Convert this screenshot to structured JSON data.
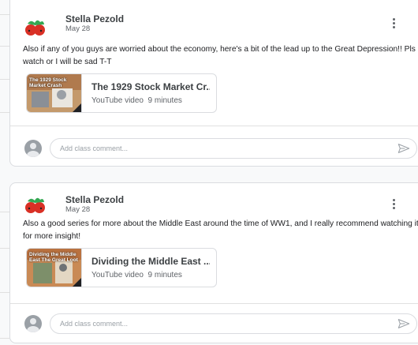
{
  "posts": [
    {
      "author": "Stella Pezold",
      "date": "May 28",
      "text": "Also if any of you guys are worried about the economy, here's a bit of the lead up to the Great Depression!! Pls watch or I will be sad T-T",
      "attachment": {
        "title": "The 1929 Stock Market Cr...",
        "type": "YouTube video",
        "duration": "9 minutes",
        "thumb_text": "The 1929 Stock Market Crash"
      },
      "comment_placeholder": "Add class comment..."
    },
    {
      "author": "Stella Pezold",
      "date": "May 28",
      "text": "Also a good series for more about the Middle East around the time of WW1, and I really recommend watching it for more insight!",
      "attachment": {
        "title": "Dividing the Middle East ...",
        "type": "YouTube video",
        "duration": "9 minutes",
        "thumb_text": "Dividing the Middle East The Great Loot"
      },
      "comment_placeholder": "Add class comment..."
    }
  ],
  "icons": {
    "avatar": "tomato-avatar-icon",
    "more": "more-vert-icon",
    "send": "send-icon",
    "commenter": "account-circle-icon"
  },
  "colors": {
    "border": "#dadce0",
    "text": "#202124",
    "secondary": "#5f6368"
  }
}
